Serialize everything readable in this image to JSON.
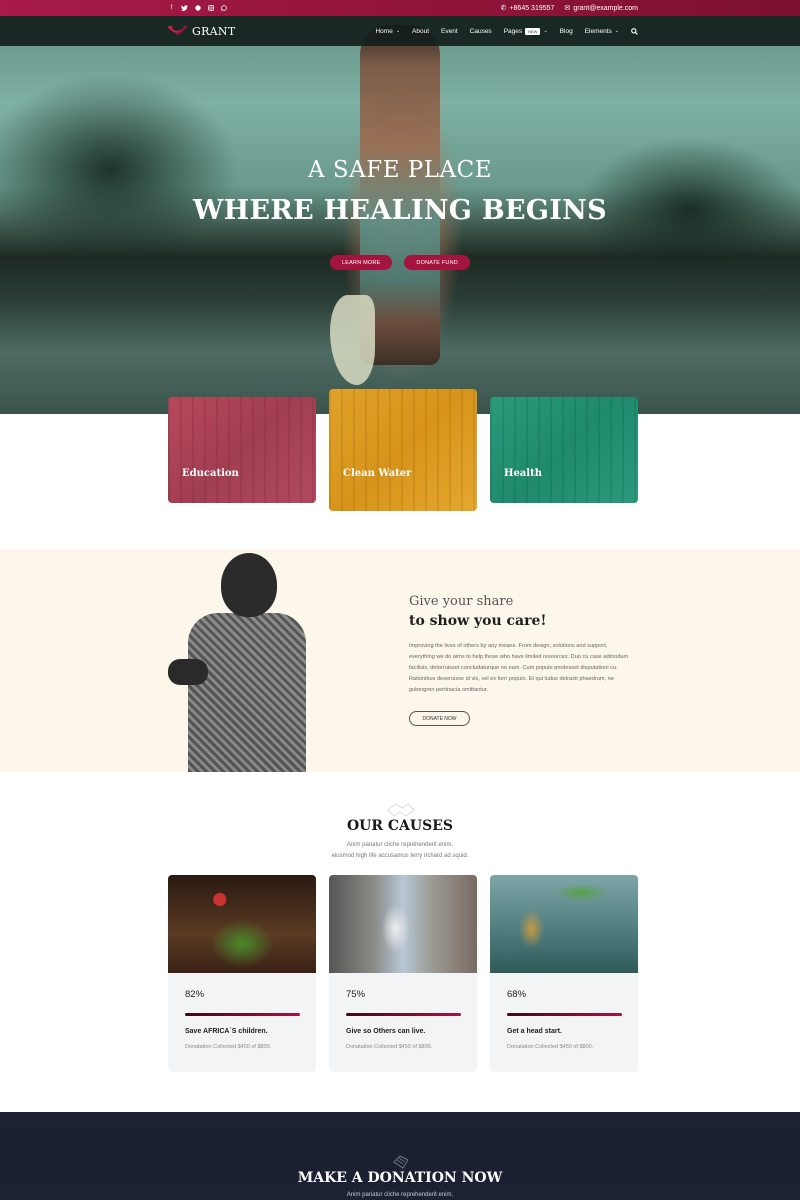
{
  "topbar": {
    "social_icons": [
      "facebook-icon",
      "twitter-icon",
      "dribbble-icon",
      "instagram-icon",
      "whatsapp-icon"
    ],
    "social_glyphs": [
      "f",
      "🐦",
      "◉",
      "◎",
      "✆"
    ],
    "phone": "+8645 319557",
    "email": "grant@example.com",
    "phone_glyph": "✆",
    "email_glyph": "✉"
  },
  "nav": {
    "logo_text": "GRANT",
    "items": [
      {
        "label": "Home",
        "has_dropdown": true
      },
      {
        "label": "About",
        "has_dropdown": false
      },
      {
        "label": "Event",
        "has_dropdown": false
      },
      {
        "label": "Causes",
        "has_dropdown": false
      },
      {
        "label": "Pages",
        "has_dropdown": true,
        "badge": "NEW"
      },
      {
        "label": "Blog",
        "has_dropdown": false
      },
      {
        "label": "Elements",
        "has_dropdown": true
      }
    ],
    "chevron": "⌄",
    "search_glyph": "🔍"
  },
  "hero": {
    "subtitle": "A SAFE PLACE",
    "title": "WHERE HEALING BEGINS",
    "buttons": [
      "LEARN MORE",
      "DONATE FUND"
    ]
  },
  "features": [
    {
      "label": "Education",
      "color": "#b7485c"
    },
    {
      "label": "Clean Water",
      "color": "#e0a22a"
    },
    {
      "label": "Health",
      "color": "#2a9b7a"
    }
  ],
  "give": {
    "heading_light": "Give your share",
    "heading_bold": "to show you care!",
    "paragraph": "Improving the lives of others by any means. From design, solutions and support, everything we do aims to help those who have limited resources. Duo cu case admodum facilisis, detorruisset concludaturque no eam. Cum populo prodesset disputationi cu. Rationibus deseruisse id vix, vel ex forri populo. Et qui ludus detraxit phaedrum, ne gubergren pertinacia omittantur.",
    "button": "DONATE NOW"
  },
  "causes": {
    "title": "OUR CAUSES",
    "subtitle_line1": "Anim pariatur cliche reprehenderit enim,",
    "subtitle_line2": "eiusmod high life accusamus terry richard ad squid.",
    "items": [
      {
        "percent": "82%",
        "title": "Save AFRICA`S children.",
        "note": "Donatation Collected $450 of $800.",
        "progress_bar_fill": 1.0
      },
      {
        "percent": "75%",
        "title": "Give so Others can live.",
        "note": "Donatation Collected $450 of $800.",
        "progress_bar_fill": 1.0
      },
      {
        "percent": "68%",
        "title": "Get a head start.",
        "note": "Donatation Collected $450 of $800.",
        "progress_bar_fill": 1.0
      }
    ]
  },
  "donation": {
    "title": "MAKE A DONATION NOW",
    "subtitle": "Anim pariatur cliche reprehenderit enim,"
  },
  "colors": {
    "brand": "#a3153f",
    "topbar": "#9a1842",
    "nav_bg": "#141e1c",
    "give_bg": "#fdf6ea",
    "donation_bg": "#1d2232"
  }
}
